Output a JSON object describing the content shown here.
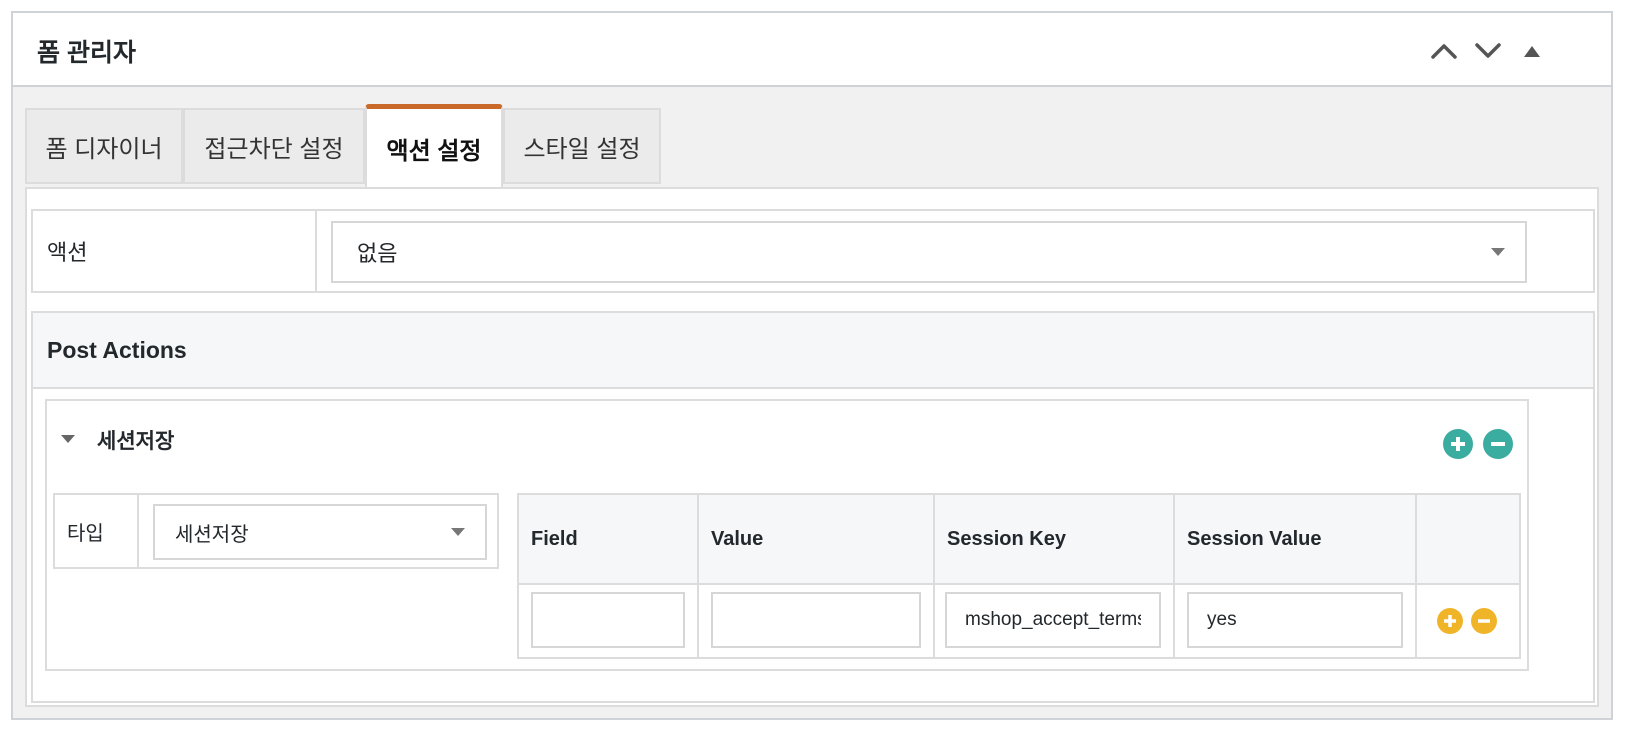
{
  "panel": {
    "title": "폼 관리자",
    "controls": [
      "chevron-up-icon",
      "chevron-down-icon",
      "triangle-up-icon"
    ]
  },
  "tabs": [
    {
      "label": "폼 디자이너",
      "active": false
    },
    {
      "label": "접근차단 설정",
      "active": false
    },
    {
      "label": "액션 설정",
      "active": true
    },
    {
      "label": "스타일 설정",
      "active": false
    }
  ],
  "action": {
    "label": "액션",
    "selected": "없음"
  },
  "post_actions": {
    "title": "Post Actions",
    "item": {
      "title": "세션저장",
      "type_label": "타입",
      "type_selected": "세션저장",
      "columns": [
        "Field",
        "Value",
        "Session Key",
        "Session Value"
      ],
      "row": {
        "field": "",
        "value": "",
        "session_key": "mshop_accept_terms",
        "session_value": "yes"
      }
    }
  },
  "colors": {
    "active_tab_accent": "#c96a2a",
    "teal_button": "#3aaca0",
    "yellow_button": "#f0b429"
  }
}
